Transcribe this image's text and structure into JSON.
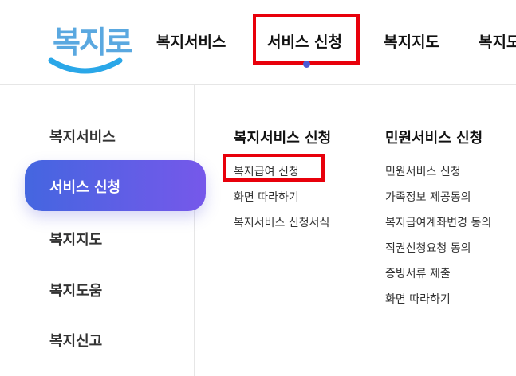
{
  "logo": {
    "text": "복지로"
  },
  "nav": {
    "items": [
      "복지서비스",
      "서비스 신청",
      "복지지도",
      "복지도"
    ]
  },
  "sidebar": {
    "items": [
      "복지서비스",
      "서비스 신청",
      "복지지도",
      "복지도움",
      "복지신고"
    ],
    "active": "서비스 신청"
  },
  "menu": {
    "col1": {
      "title": "복지서비스 신청",
      "links": [
        "복지급여 신청",
        "화면 따라하기",
        "복지서비스 신청서식"
      ]
    },
    "col2": {
      "title": "민원서비스 신청",
      "links": [
        "민원서비스 신청",
        "가족정보 제공동의",
        "복지급여계좌변경 동의",
        "직권신청요청 동의",
        "증빙서류 제출",
        "화면 따라하기"
      ]
    }
  },
  "colors": {
    "accent_start": "#4466e0",
    "accent_end": "#7658ea",
    "highlight": "#e8000b",
    "logo": "#5aa8e0"
  }
}
